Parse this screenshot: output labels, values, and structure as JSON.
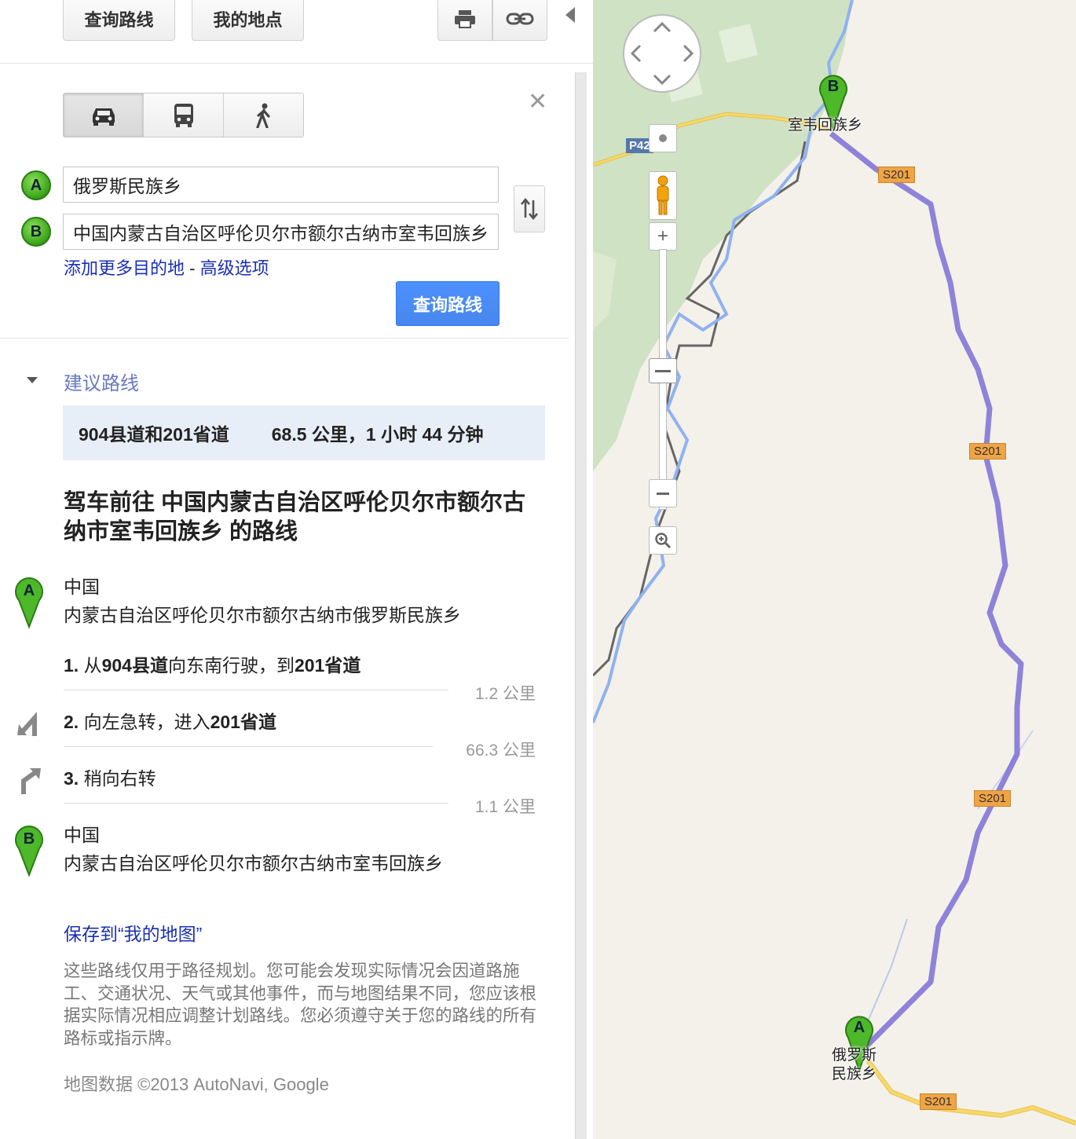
{
  "toolbar": {
    "directions_label": "查询路线",
    "my_places_label": "我的地点"
  },
  "modes": [
    "driving-icon",
    "transit-icon",
    "walking-icon"
  ],
  "waypoints": {
    "a_letter": "A",
    "b_letter": "B",
    "a_value": "俄罗斯民族乡",
    "b_value": "中国内蒙古自治区呼伦贝尔市额尔古纳市室韦回族乡"
  },
  "links": {
    "add_destination": "添加更多目的地",
    "separator": " - ",
    "advanced": "高级选项"
  },
  "search_button": "查询路线",
  "suggested": {
    "heading": "建议路线",
    "route_name": "904县道和201省道",
    "route_summary": "68.5 公里，1 小时 44 分钟"
  },
  "directions_title": "驾车前往 中国内蒙古自治区呼伦贝尔市额尔古纳市室韦回族乡 的路线",
  "start": {
    "country": "中国",
    "address": "内蒙古自治区呼伦贝尔市额尔古纳市俄罗斯民族乡"
  },
  "steps": [
    {
      "num": "1.",
      "text_a": "从",
      "bold_a": "904县道",
      "text_b": "向东南行驶，到",
      "bold_b": "201省道",
      "dist": "1.2 公里"
    },
    {
      "num": "2.",
      "text_a": "向左急转，进入",
      "bold_a": "201省道",
      "text_b": "",
      "bold_b": "",
      "dist": "66.3 公里"
    },
    {
      "num": "3.",
      "text_a": "稍向右转",
      "bold_a": "",
      "text_b": "",
      "bold_b": "",
      "dist": "1.1 公里"
    }
  ],
  "end": {
    "country": "中国",
    "address": "内蒙古自治区呼伦贝尔市额尔古纳市室韦回族乡"
  },
  "save_link": "保存到“我的地图”",
  "disclaimer": "这些路线仅用于路径规划。您可能会发现实际情况会因道路施工、交通状况、天气或其他事件，而与地图结果不同，您应该根据实际情况相应调整计划路线。您必须遵守关于您的路线的所有路标或指示牌。",
  "map_data_credit": "地图数据 ©2013 AutoNavi, Google",
  "map": {
    "label_b": "室韦回族乡",
    "label_a_line1": "俄罗斯",
    "label_a_line2": "民族乡",
    "road_badges": [
      "S201",
      "S201",
      "S201",
      "S201",
      "P42"
    ],
    "route_color": "#7b6fd6",
    "river_color": "#8fb2f0",
    "forest_color": "#cfe2c4",
    "road_color": "#f6d86b"
  }
}
